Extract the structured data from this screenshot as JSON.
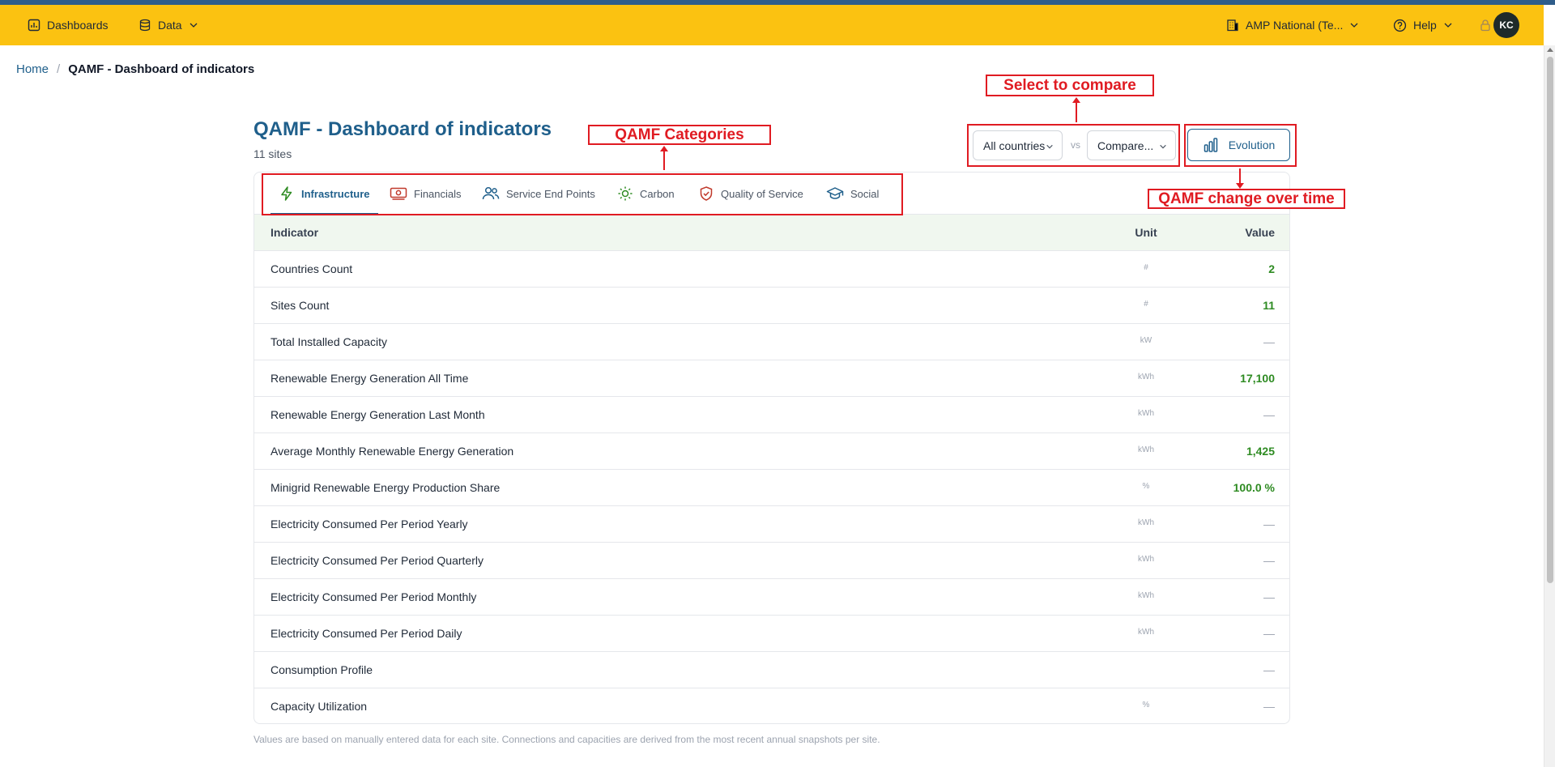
{
  "nav": {
    "dashboards": "Dashboards",
    "data": "Data",
    "org": "AMP National (Te...",
    "help": "Help",
    "avatar_initials": "KC"
  },
  "breadcrumb": {
    "home": "Home",
    "separator": "/",
    "current": "QAMF - Dashboard of indicators"
  },
  "header": {
    "title": "QAMF - Dashboard of indicators",
    "subtitle": "11 sites"
  },
  "compare": {
    "primary": "All countries",
    "vs": "vs",
    "secondary": "Compare...",
    "evolution": "Evolution"
  },
  "tabs": [
    {
      "label": "Infrastructure",
      "icon": "bolt-icon",
      "active": true
    },
    {
      "label": "Financials",
      "icon": "money-icon",
      "active": false
    },
    {
      "label": "Service End Points",
      "icon": "users-icon",
      "active": false
    },
    {
      "label": "Carbon",
      "icon": "sun-icon",
      "active": false
    },
    {
      "label": "Quality of Service",
      "icon": "shield-check-icon",
      "active": false
    },
    {
      "label": "Social",
      "icon": "graduation-cap-icon",
      "active": false
    }
  ],
  "table": {
    "headers": {
      "indicator": "Indicator",
      "unit": "Unit",
      "value": "Value"
    },
    "rows": [
      {
        "indicator": "Countries Count",
        "unit": "#",
        "value": "2"
      },
      {
        "indicator": "Sites Count",
        "unit": "#",
        "value": "11"
      },
      {
        "indicator": "Total Installed Capacity",
        "unit": "kW",
        "value": "—"
      },
      {
        "indicator": "Renewable Energy Generation All Time",
        "unit": "kWh",
        "value": "17,100"
      },
      {
        "indicator": "Renewable Energy Generation Last Month",
        "unit": "kWh",
        "value": "—"
      },
      {
        "indicator": "Average Monthly Renewable Energy Generation",
        "unit": "kWh",
        "value": "1,425"
      },
      {
        "indicator": "Minigrid Renewable Energy Production Share",
        "unit": "%",
        "value": "100.0 %"
      },
      {
        "indicator": "Electricity Consumed Per Period Yearly",
        "unit": "kWh",
        "value": "—"
      },
      {
        "indicator": "Electricity Consumed Per Period Quarterly",
        "unit": "kWh",
        "value": "—"
      },
      {
        "indicator": "Electricity Consumed Per Period Monthly",
        "unit": "kWh",
        "value": "—"
      },
      {
        "indicator": "Electricity Consumed Per Period Daily",
        "unit": "kWh",
        "value": "—"
      },
      {
        "indicator": "Consumption Profile",
        "unit": "",
        "value": "—"
      },
      {
        "indicator": "Capacity Utilization",
        "unit": "%",
        "value": "—"
      }
    ]
  },
  "footnote": "Values are based on manually entered data for each site. Connections and capacities are derived from the most recent annual snapshots per site.",
  "annotations": {
    "categories": "QAMF Categories",
    "compare": "Select to compare",
    "evolution": "QAMF change over time"
  },
  "colors": {
    "navbar": "#fbc211",
    "accent": "#1f5f8b",
    "positive_value": "#2e8b22",
    "annotation": "#e01b22"
  }
}
